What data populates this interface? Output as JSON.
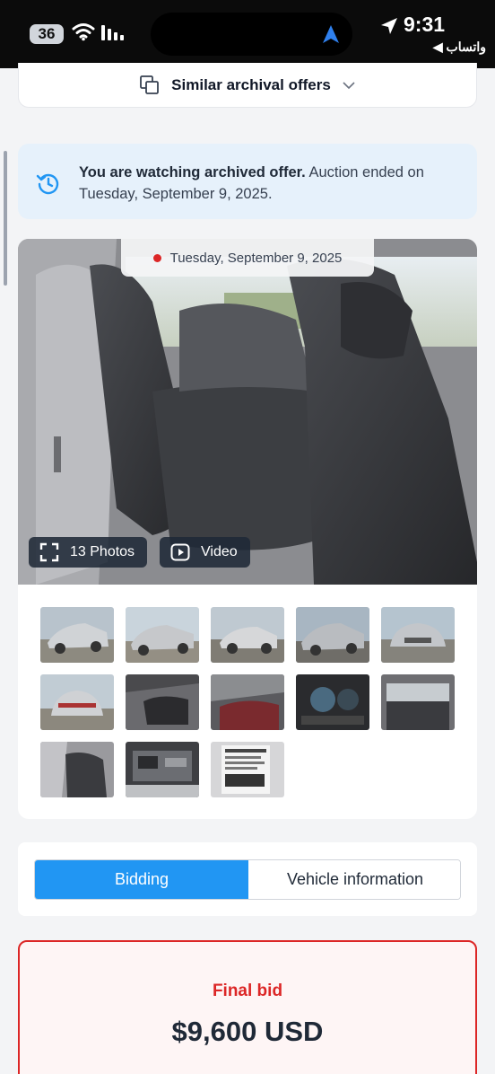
{
  "status_bar": {
    "battery_level": "36",
    "time": "9:31",
    "back_app": "◀ واتساب"
  },
  "similar": {
    "label": "Similar archival offers"
  },
  "archive_banner": {
    "bold_text": "You are watching archived offer.",
    "text": " Auction ended on Tuesday, September 9, 2025."
  },
  "gallery": {
    "date": "Tuesday, September 9, 2025",
    "photos_label": "13 Photos",
    "video_label": "Video",
    "thumbnail_count": 13
  },
  "tabs": {
    "bidding": "Bidding",
    "vehicle_information": "Vehicle information",
    "active": "Bidding"
  },
  "final_bid": {
    "title": "Final bid",
    "amount": "$9,600 USD"
  },
  "colors": {
    "accent": "#2196f3",
    "alert": "#dc2626",
    "banner_bg": "#e6f1fb"
  }
}
